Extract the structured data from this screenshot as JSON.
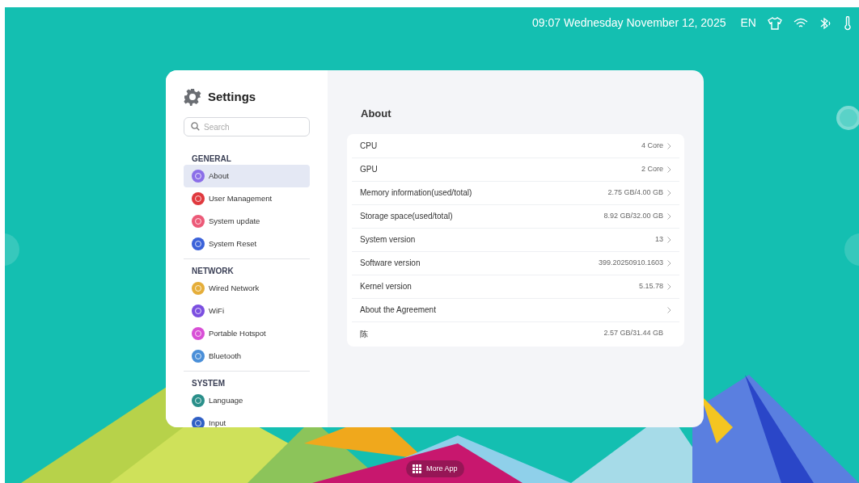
{
  "status_bar": {
    "datetime": "09:07 Wednesday November 12, 2025",
    "language": "EN"
  },
  "settings": {
    "title": "Settings",
    "search": {
      "placeholder": "Search"
    },
    "sections": [
      {
        "header": "GENERAL",
        "items": [
          {
            "label": "About",
            "color": "#8b6ee8",
            "selected": true
          },
          {
            "label": "User Management",
            "color": "#e0393e",
            "selected": false
          },
          {
            "label": "System update",
            "color": "#ec5a78",
            "selected": false
          },
          {
            "label": "System Reset",
            "color": "#3b62d9",
            "selected": false
          }
        ]
      },
      {
        "header": "NETWORK",
        "items": [
          {
            "label": "Wired Network",
            "color": "#e5ae3a",
            "selected": false
          },
          {
            "label": "WiFi",
            "color": "#7b4fe0",
            "selected": false
          },
          {
            "label": "Portable Hotspot",
            "color": "#d84fd6",
            "selected": false
          },
          {
            "label": "Bluetooth",
            "color": "#4a8fd8",
            "selected": false
          }
        ]
      },
      {
        "header": "SYSTEM",
        "items": [
          {
            "label": "Language",
            "color": "#2a8f8a",
            "selected": false
          },
          {
            "label": "Input",
            "color": "#2f5fc4",
            "selected": false
          }
        ]
      }
    ]
  },
  "about": {
    "title": "About",
    "rows": [
      {
        "label": "CPU",
        "value": "4 Core",
        "chevron": true
      },
      {
        "label": "GPU",
        "value": "2 Core",
        "chevron": true
      },
      {
        "label": "Memory information(used/total)",
        "value": "2.75 GB/4.00 GB",
        "chevron": true
      },
      {
        "label": "Storage space(used/total)",
        "value": "8.92 GB/32.00 GB",
        "chevron": true
      },
      {
        "label": "System version",
        "value": "13",
        "chevron": true
      },
      {
        "label": "Software version",
        "value": "399.20250910.1603",
        "chevron": true
      },
      {
        "label": "Kernel version",
        "value": "5.15.78",
        "chevron": true
      },
      {
        "label": "About the Agreement",
        "value": "",
        "chevron": true
      },
      {
        "label": "陈",
        "value": "2.57 GB/31.44 GB",
        "chevron": false
      }
    ]
  },
  "dock": {
    "label": "More App"
  }
}
